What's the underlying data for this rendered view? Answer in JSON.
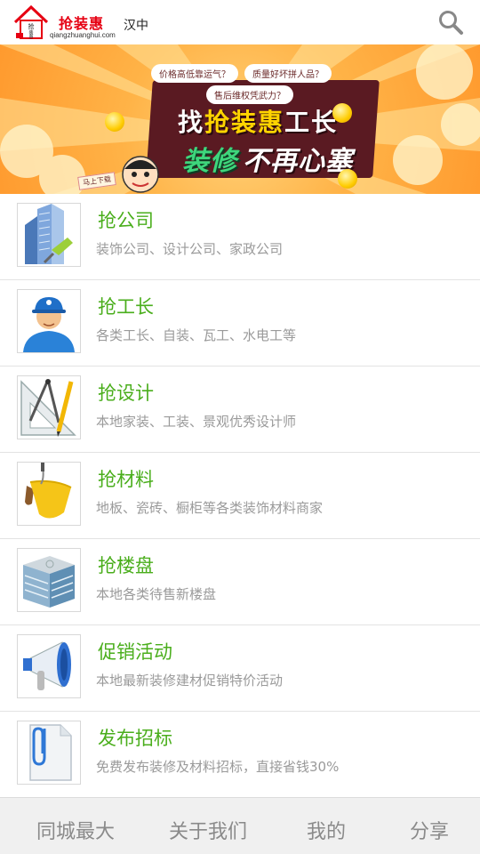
{
  "header": {
    "logo_name": "抢装惠",
    "logo_domain": "qiangzhuanghui.com",
    "logo_house_text": "抢装惠",
    "city": "汉中",
    "search_icon": "search-icon"
  },
  "banner": {
    "bubble1": "价格高低靠运气？",
    "bubble2": "质量好坏拼人品？",
    "bubble3": "售后维权凭武力？",
    "title_prefix": "找",
    "title_brand": "抢装惠",
    "title_suffix": "工长",
    "slogan_green": "装修",
    "slogan_white": "不再心塞",
    "tag": "马上下载"
  },
  "list": [
    {
      "title": "抢公司",
      "subtitle": "装饰公司、设计公司、家政公司",
      "icon": "building-icon"
    },
    {
      "title": "抢工长",
      "subtitle": "各类工长、自装、瓦工、水电工等",
      "icon": "worker-icon"
    },
    {
      "title": "抢设计",
      "subtitle": "本地家装、工装、景观优秀设计师",
      "icon": "drafting-tools-icon"
    },
    {
      "title": "抢材料",
      "subtitle": "地板、瓷砖、橱柜等各类装饰材料商家",
      "icon": "paint-bucket-icon"
    },
    {
      "title": "抢楼盘",
      "subtitle": "本地各类待售新楼盘",
      "icon": "office-building-icon"
    },
    {
      "title": "促销活动",
      "subtitle": "本地最新装修建材促销特价活动",
      "icon": "megaphone-icon"
    },
    {
      "title": "发布招标",
      "subtitle": "免费发布装修及材料招标，直接省钱30%",
      "icon": "paperclip-document-icon"
    }
  ],
  "footer": {
    "tabs": [
      "同城最大",
      "关于我们",
      "我的",
      "分享"
    ]
  },
  "colors": {
    "accent_green": "#4aae1c",
    "brand_red": "#e60012",
    "subtitle_gray": "#9a9a9a",
    "footer_bg": "#f0f0f0"
  }
}
